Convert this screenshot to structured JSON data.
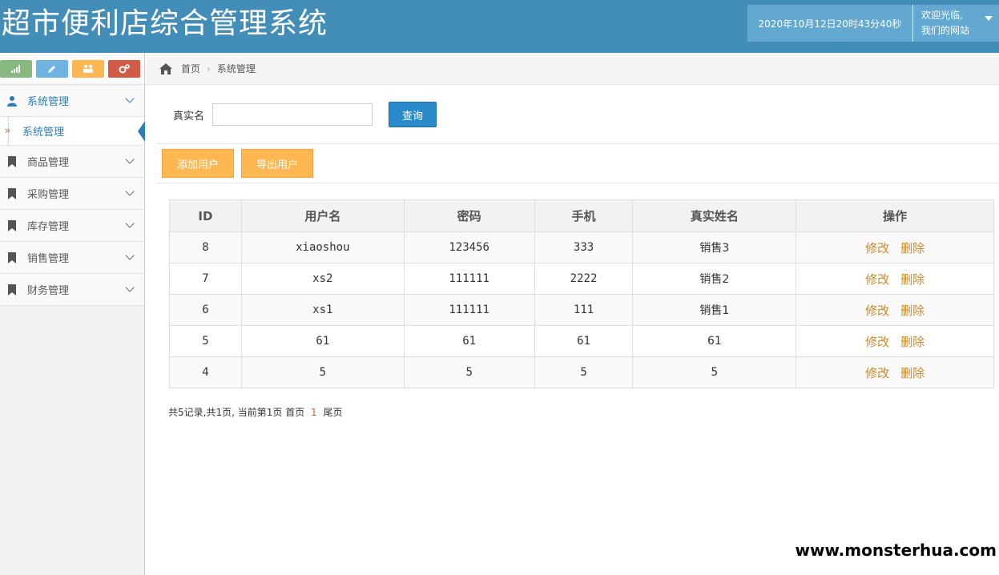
{
  "header": {
    "title": "超市便利店综合管理系统",
    "datetime": "2020年10月12日20时43分40秒",
    "welcome_line1": "欢迎光临,",
    "welcome_line2": "我们的网站"
  },
  "shortcuts": [
    {
      "icon": "signal-icon",
      "color": "#87b87f"
    },
    {
      "icon": "pencil-icon",
      "color": "#6fb3e0"
    },
    {
      "icon": "users-icon",
      "color": "#ffb752"
    },
    {
      "icon": "cogs-icon",
      "color": "#d15b47"
    }
  ],
  "sidebar": {
    "items": [
      {
        "label": "系统管理",
        "icon": "user-icon"
      },
      {
        "label": "商品管理",
        "icon": "bookmark-icon"
      },
      {
        "label": "采购管理",
        "icon": "bookmark-icon"
      },
      {
        "label": "库存管理",
        "icon": "bookmark-icon"
      },
      {
        "label": "销售管理",
        "icon": "bookmark-icon"
      },
      {
        "label": "财务管理",
        "icon": "bookmark-icon"
      }
    ],
    "sub_items": [
      {
        "label": "系统管理"
      }
    ]
  },
  "breadcrumb": {
    "home": "首页",
    "current": "系统管理"
  },
  "search": {
    "label": "真实名",
    "value": "",
    "button": "查询"
  },
  "toolbar": {
    "add_user": "添加用户",
    "export_user": "导出用户"
  },
  "table": {
    "headers": [
      "ID",
      "用户名",
      "密码",
      "手机",
      "真实姓名",
      "操作"
    ],
    "rows": [
      {
        "id": "8",
        "username": "xiaoshou",
        "password": "123456",
        "phone": "333",
        "realname": "销售3"
      },
      {
        "id": "7",
        "username": "xs2",
        "password": "111111",
        "phone": "2222",
        "realname": "销售2"
      },
      {
        "id": "6",
        "username": "xs1",
        "password": "111111",
        "phone": "111",
        "realname": "销售1"
      },
      {
        "id": "5",
        "username": "61",
        "password": "61",
        "phone": "61",
        "realname": "61"
      },
      {
        "id": "4",
        "username": "5",
        "password": "5",
        "phone": "5",
        "realname": "5"
      }
    ],
    "edit_label": "修改",
    "delete_label": "删除"
  },
  "pager": {
    "summary": "共5记录,共1页, 当前第1页",
    "first": "首页",
    "current": "1",
    "last": "尾页"
  },
  "watermark": "www.monsterhua.com",
  "colors": {
    "header_bg": "#438eb9",
    "accent_blue": "#2b7dbc",
    "warning": "#ffb752",
    "action": "#c98a2a"
  }
}
